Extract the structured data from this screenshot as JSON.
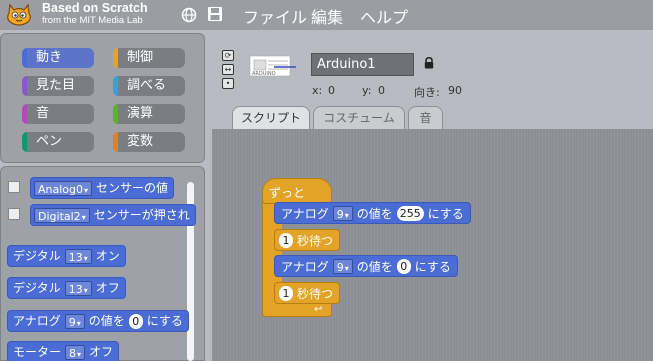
{
  "app": {
    "logo_title": "Based on Scratch",
    "logo_subtitle": "from the MIT Media Lab"
  },
  "menu": {
    "globe_icon": "globe-icon",
    "save_icon": "save-icon",
    "items": [
      "ファイル",
      "編集",
      "ヘルプ"
    ]
  },
  "categories": [
    {
      "label": "動き",
      "color": "#4a6cd4",
      "selected": true
    },
    {
      "label": "制御",
      "color": "#e1a91a"
    },
    {
      "label": "見た目",
      "color": "#8a55d7"
    },
    {
      "label": "調べる",
      "color": "#2ca5e2"
    },
    {
      "label": "音",
      "color": "#bb42c3"
    },
    {
      "label": "演算",
      "color": "#5cb712"
    },
    {
      "label": "ペン",
      "color": "#0e9a6c"
    },
    {
      "label": "変数",
      "color": "#ee7d16"
    }
  ],
  "palette": {
    "sensor_analog": {
      "dropdown": "Analog0",
      "text": "センサーの値"
    },
    "sensor_digital": {
      "dropdown": "Digital2",
      "text": "センサーが押され"
    },
    "digital_on": {
      "label": "デジタル",
      "pin": "13",
      "state": "オン"
    },
    "digital_off": {
      "label": "デジタル",
      "pin": "13",
      "state": "オフ"
    },
    "analog": {
      "label": "アナログ",
      "pin": "9",
      "text": "の値を",
      "value": "0",
      "suffix": "にする"
    },
    "motor": {
      "label": "モーター",
      "pin": "8",
      "state": "オフ"
    }
  },
  "sprite": {
    "name": "Arduino1",
    "x_label": "x:",
    "x": "0",
    "y_label": "y:",
    "y": "0",
    "dir_label": "向き:",
    "direction": "90"
  },
  "tabs": [
    "スクリプト",
    "コスチューム",
    "音"
  ],
  "script": {
    "hat": "ずっと",
    "block1": {
      "label": "アナログ",
      "pin": "9",
      "text": "の値を",
      "value": "255",
      "suffix": "にする"
    },
    "wait1": {
      "value": "1",
      "label": "秒待つ"
    },
    "block2": {
      "label": "アナログ",
      "pin": "9",
      "text": "の値を",
      "value": "0",
      "suffix": "にする"
    },
    "wait2": {
      "value": "1",
      "label": "秒待つ"
    }
  }
}
